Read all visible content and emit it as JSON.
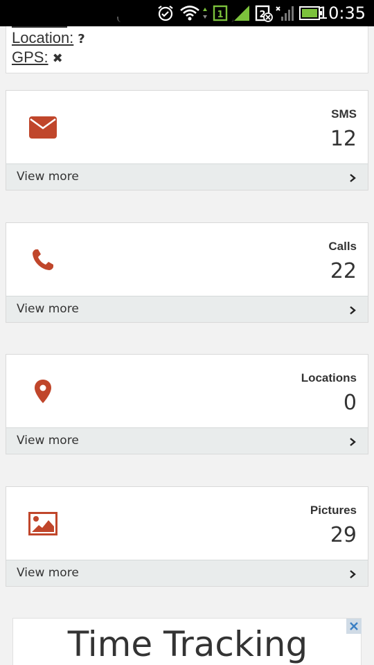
{
  "status_bar": {
    "time": "10:35",
    "icons": [
      "alarm-icon",
      "wifi-icon",
      "sim1-icon",
      "signal-icon",
      "sim2-no-signal-icon",
      "battery-icon"
    ],
    "colors": {
      "background": "#000000",
      "signal": "#7cc23c"
    }
  },
  "device_info": {
    "location_label": "Location:",
    "location_value": "?",
    "gps_label": "GPS:",
    "gps_value": "✖"
  },
  "cards": [
    {
      "icon": "envelope-icon",
      "title": "SMS",
      "count": "12",
      "footer": "View more"
    },
    {
      "icon": "phone-icon",
      "title": "Calls",
      "count": "22",
      "footer": "View more"
    },
    {
      "icon": "map-pin-icon",
      "title": "Locations",
      "count": "0",
      "footer": "View more"
    },
    {
      "icon": "picture-icon",
      "title": "Pictures",
      "count": "29",
      "footer": "View more"
    }
  ],
  "ad": {
    "text": "Time Tracking",
    "close_icon": "close-icon"
  },
  "colors": {
    "accent": "#c0462b",
    "footer_bg": "#e9ecec"
  }
}
